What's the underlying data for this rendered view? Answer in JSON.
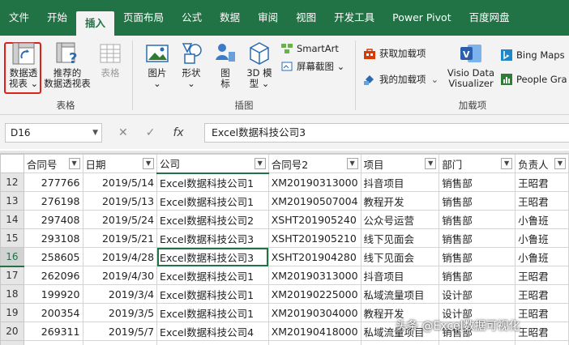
{
  "tabs": [
    "文件",
    "开始",
    "插入",
    "页面布局",
    "公式",
    "数据",
    "审阅",
    "视图",
    "开发工具",
    "Power Pivot",
    "百度网盘"
  ],
  "active_tab_index": 2,
  "ribbon": {
    "tables_group": {
      "label": "表格",
      "pivot": "数据透\n视表 ⌄",
      "pivot_line1": "数据透",
      "pivot_line2": "视表 ⌄",
      "recommended_line1": "推荐的",
      "recommended_line2": "数据透视表",
      "table": "表格"
    },
    "illustrations_group": {
      "label": "插图",
      "pictures": "图片",
      "pictures_dd": "⌄",
      "shapes": "形状",
      "shapes_dd": "⌄",
      "icons_line1": "图",
      "icons_line2": "标",
      "model_line1": "3D 模",
      "model_line2": "型 ⌄",
      "smartart": "SmartArt",
      "screenshot": "屏幕截图 ⌄"
    },
    "addins_group": {
      "label": "加载项",
      "get_addins": "获取加载项",
      "my_addins": "我的加载项",
      "my_addins_dd": "⌄",
      "visio_line1": "Visio Data",
      "visio_line2": "Visualizer",
      "bing_maps": "Bing Maps",
      "people_graph": "People Gra"
    }
  },
  "formula_bar": {
    "name_box": "D16",
    "cancel_icon": "✕",
    "enter_icon": "✓",
    "fx": "fx",
    "value": "Excel数据科技公司3"
  },
  "headers": [
    "合同号",
    "日期",
    "公司",
    "合同号2",
    "项目",
    "部门",
    "负责人"
  ],
  "rows": [
    {
      "n": "12",
      "c": [
        "277766",
        "2019/5/14",
        "Excel数据科技公司1",
        "XM20190313000",
        "抖音项目",
        "销售部",
        "王昭君"
      ]
    },
    {
      "n": "13",
      "c": [
        "276198",
        "2019/5/13",
        "Excel数据科技公司1",
        "XM20190507004",
        "教程开发",
        "销售部",
        "王昭君"
      ]
    },
    {
      "n": "14",
      "c": [
        "297408",
        "2019/5/24",
        "Excel数据科技公司2",
        "XSHT201905240",
        "公众号运营",
        "销售部",
        "小鲁班"
      ]
    },
    {
      "n": "15",
      "c": [
        "293108",
        "2019/5/21",
        "Excel数据科技公司3",
        "XSHT201905210",
        "线下见面会",
        "销售部",
        "小鲁班"
      ]
    },
    {
      "n": "16",
      "c": [
        "258605",
        "2019/4/28",
        "Excel数据科技公司3",
        "XSHT201904280",
        "线下见面会",
        "销售部",
        "小鲁班"
      ]
    },
    {
      "n": "17",
      "c": [
        "262096",
        "2019/4/30",
        "Excel数据科技公司1",
        "XM20190313000",
        "抖音项目",
        "销售部",
        "王昭君"
      ]
    },
    {
      "n": "18",
      "c": [
        "199920",
        "2019/3/4",
        "Excel数据科技公司1",
        "XM20190225000",
        "私域流量项目",
        "设计部",
        "王昭君"
      ]
    },
    {
      "n": "19",
      "c": [
        "200354",
        "2019/3/5",
        "Excel数据科技公司1",
        "XM20190304000",
        "教程开发",
        "设计部",
        "王昭君"
      ]
    },
    {
      "n": "20",
      "c": [
        "269311",
        "2019/5/7",
        "Excel数据科技公司4",
        "XM20190418000",
        "私域流量项目",
        "销售部",
        "王昭君"
      ]
    },
    {
      "n": "21",
      "c": [
        "",
        "",
        "",
        "",
        "",
        "",
        ""
      ]
    }
  ],
  "header_row_num": "",
  "watermark": "头条 @Excel数据可视化",
  "colors": {
    "accent": "#217346",
    "highlight": "#e0201b"
  }
}
